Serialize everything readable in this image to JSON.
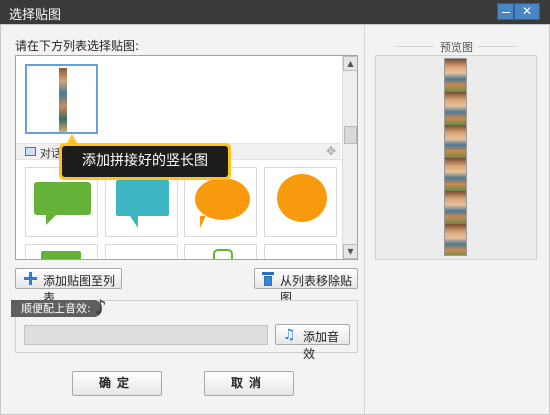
{
  "window": {
    "title": "选择贴图",
    "minimize_label": "–",
    "close_label": "✕"
  },
  "list": {
    "instruction": "请在下方列表选择贴图:",
    "group_label": "对话",
    "items": [
      {
        "icon": "green-speech-bubble"
      },
      {
        "icon": "teal-speech-bubble"
      },
      {
        "icon": "orange-speech-bubble"
      },
      {
        "icon": "orange-round-speech-bubble"
      }
    ],
    "scroll_up": "▲",
    "scroll_down": "▼"
  },
  "tooltip": {
    "text": "添加拼接好的竖长图"
  },
  "buttons": {
    "add_to_list": "添加贴图至列表",
    "remove_from_list": "从列表移除贴图",
    "add_sound": "添加音效",
    "ok": "确定",
    "cancel": "取消"
  },
  "sound": {
    "label": "顺便配上音效:",
    "field_value": ""
  },
  "preview": {
    "title": "预览图"
  },
  "colors": {
    "titlebar": "#3a3a3a",
    "accent_blue": "#2b7ed0",
    "tooltip_border": "#ffc21f",
    "bubble_green": "#64b238",
    "bubble_teal": "#3db5c2",
    "bubble_orange": "#f79a0e"
  }
}
